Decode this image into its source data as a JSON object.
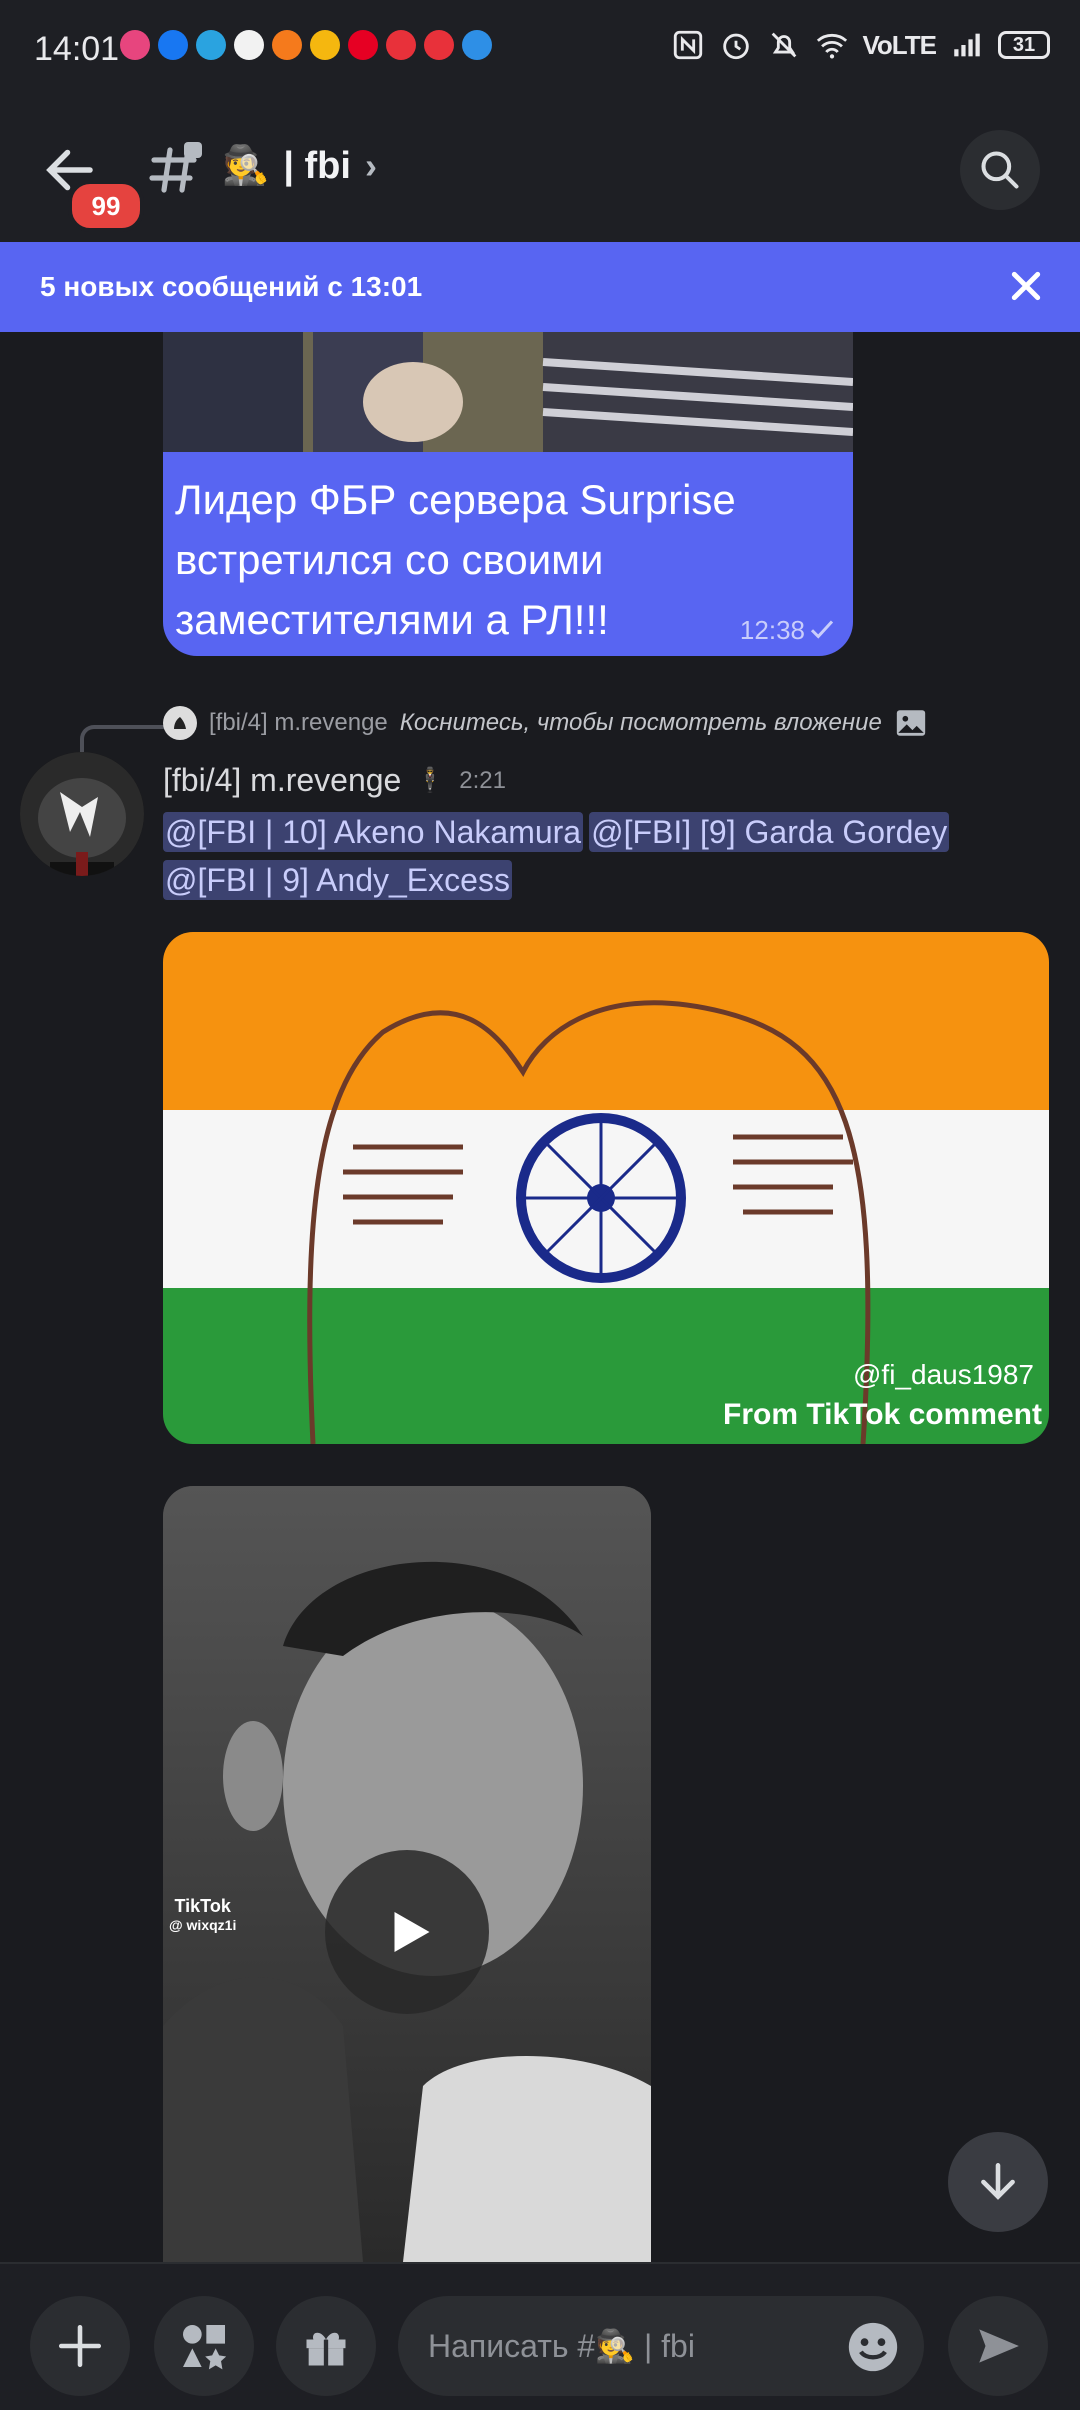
{
  "status_bar": {
    "time": "14:01",
    "network": "VoLTE",
    "battery": "31",
    "app_icon_colors": [
      "#e7457e",
      "#1877f2",
      "#2aa3e0",
      "#f2f2f2",
      "#f57a1c",
      "#f5b70f",
      "#e60023",
      "#e8313a",
      "#e8313a",
      "#2e8fe6"
    ]
  },
  "header": {
    "unread_badge": "99",
    "channel_emoji": "🕵",
    "channel_name": "| fbi",
    "chevron": "›"
  },
  "banner": {
    "text": "5 новых сообщений с 13:01"
  },
  "messages": {
    "meme": {
      "caption": "Лидер ФБР сервера Surprise встретился со своими заместителями а РЛ!!!",
      "time": "12:38"
    },
    "reply": {
      "author": "[fbi/4] m.revenge",
      "text": "Коснитесь, чтобы посмотреть вложение"
    },
    "post": {
      "author": "[fbi/4] m.revenge",
      "author_emoji": "🕴",
      "time": "2:21",
      "mentions": [
        "@[FBI | 10] Akeno Nakamura",
        "@[FBI]  [9] Garda Gordey",
        "@[FBI | 9] Andy_Excess"
      ],
      "flag_watermark": "@fi_daus1987",
      "flag_tiktok": "From TikTok comment",
      "video_tiktok": "TikTok",
      "video_handle": "@ wixqz1i"
    }
  },
  "composer": {
    "placeholder": "Написать #🕵 | fbi"
  },
  "colors": {
    "accent": "#5865f2",
    "badge": "#e5433f",
    "background": "#1a1b1f",
    "mention_bg": "#3c4270"
  }
}
